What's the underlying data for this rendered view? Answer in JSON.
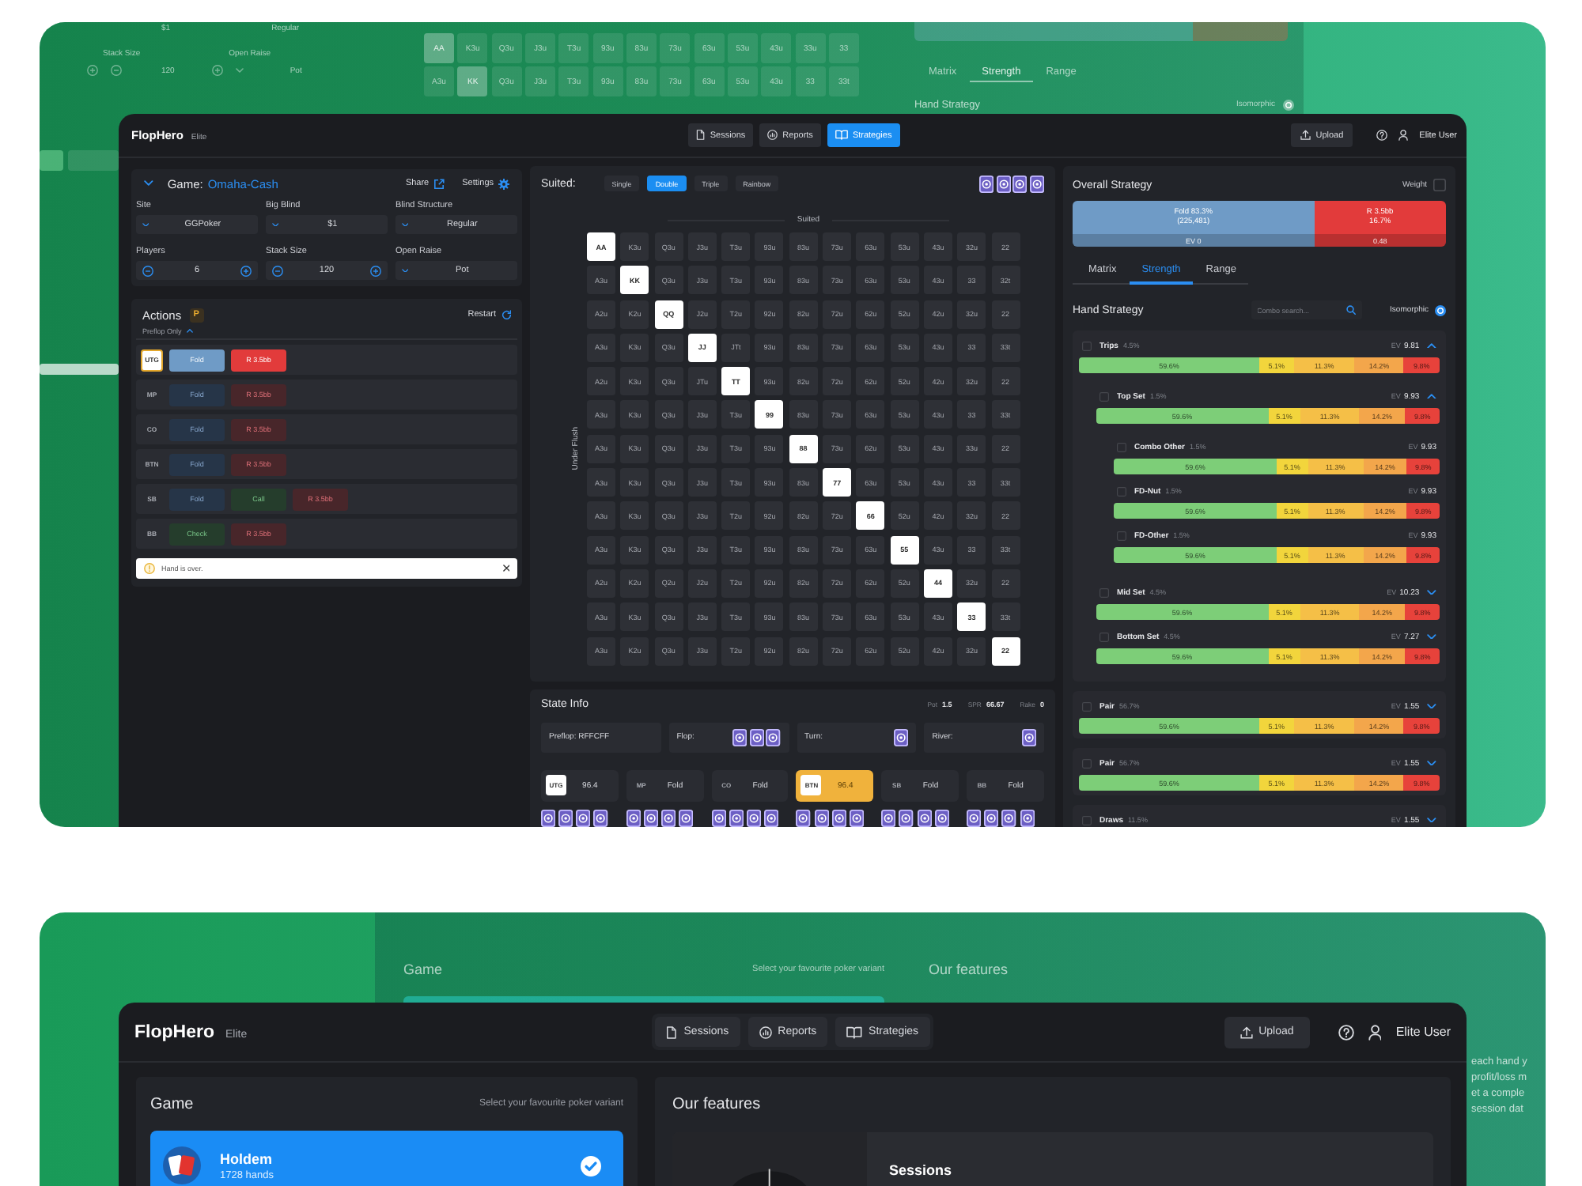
{
  "top_backdrop": {
    "field_values": [
      "$1",
      "Regular"
    ],
    "field_labels": [
      "Stack Size",
      "Open Raise"
    ],
    "stack_size": "120",
    "open_raise": "Pot",
    "matrix_rows": [
      [
        {
          "label": "AA",
          "selected": true
        },
        {
          "label": "K3u",
          "selected": false
        },
        {
          "label": "Q3u",
          "selected": false
        },
        {
          "label": "J3u",
          "selected": false
        },
        {
          "label": "T3u",
          "selected": false
        },
        {
          "label": "93u",
          "selected": false
        },
        {
          "label": "83u",
          "selected": false
        },
        {
          "label": "73u",
          "selected": false
        },
        {
          "label": "63u",
          "selected": false
        },
        {
          "label": "53u",
          "selected": false
        },
        {
          "label": "43u",
          "selected": false
        },
        {
          "label": "33u",
          "selected": false
        },
        {
          "label": "33",
          "selected": false
        }
      ],
      [
        {
          "label": "A3u",
          "selected": false
        },
        {
          "label": "KK",
          "selected": true
        },
        {
          "label": "Q3u",
          "selected": false
        },
        {
          "label": "J3u",
          "selected": false
        },
        {
          "label": "T3u",
          "selected": false
        },
        {
          "label": "93u",
          "selected": false
        },
        {
          "label": "83u",
          "selected": false
        },
        {
          "label": "73u",
          "selected": false
        },
        {
          "label": "63u",
          "selected": false
        },
        {
          "label": "53u",
          "selected": false
        },
        {
          "label": "43u",
          "selected": false
        },
        {
          "label": "33",
          "selected": false
        },
        {
          "label": "33t",
          "selected": false
        }
      ]
    ],
    "tabs": [
      {
        "label": "Matrix",
        "selected": false
      },
      {
        "label": "Strength",
        "selected": true
      },
      {
        "label": "Range",
        "selected": false
      }
    ],
    "hand_strategy": "Hand Strategy",
    "isomorphic": "Isomorphic"
  },
  "top_window": {
    "header": {
      "brand": "FlopHero",
      "plan": "Elite",
      "nav": [
        {
          "label": "Sessions",
          "selected": false
        },
        {
          "label": "Reports",
          "selected": false
        },
        {
          "label": "Strategies",
          "selected": true
        }
      ],
      "upload": "Upload",
      "user": "Elite User"
    },
    "game": {
      "label": "Game:",
      "value": "Omaha-Cash",
      "share": "Share",
      "settings": "Settings",
      "fields": [
        {
          "kind": "select",
          "label": "Site",
          "value": "GGPoker"
        },
        {
          "kind": "select",
          "label": "Big Blind",
          "value": "$1"
        },
        {
          "kind": "select",
          "label": "Blind Structure",
          "value": "Regular"
        },
        {
          "kind": "stepper",
          "label": "Players",
          "value": "6"
        },
        {
          "kind": "stepper",
          "label": "Stack Size",
          "value": "120"
        },
        {
          "kind": "select",
          "label": "Open Raise",
          "value": "Pot"
        }
      ]
    },
    "actions": {
      "title": "Actions",
      "badge": "P",
      "restart": "Restart",
      "filter": "Preflop Only",
      "rows": [
        {
          "position": "UTG",
          "selected": true,
          "buttons": [
            {
              "label": "Fold",
              "kind": "fold"
            },
            {
              "label": "R 3.5bb",
              "kind": "raise"
            }
          ]
        },
        {
          "position": "MP",
          "selected": false,
          "buttons": [
            {
              "label": "Fold",
              "kind": "fold"
            },
            {
              "label": "R 3.5bb",
              "kind": "raise"
            }
          ]
        },
        {
          "position": "CO",
          "selected": false,
          "buttons": [
            {
              "label": "Fold",
              "kind": "fold"
            },
            {
              "label": "R 3.5bb",
              "kind": "raise"
            }
          ]
        },
        {
          "position": "BTN",
          "selected": false,
          "buttons": [
            {
              "label": "Fold",
              "kind": "fold"
            },
            {
              "label": "R 3.5bb",
              "kind": "raise"
            }
          ]
        },
        {
          "position": "SB",
          "selected": false,
          "buttons": [
            {
              "label": "Fold",
              "kind": "fold"
            },
            {
              "label": "Call",
              "kind": "call"
            },
            {
              "label": "R 3.5bb",
              "kind": "raise"
            }
          ]
        },
        {
          "position": "BB",
          "selected": false,
          "buttons": [
            {
              "label": "Check",
              "kind": "call"
            },
            {
              "label": "R 3.5bb",
              "kind": "raise"
            }
          ]
        }
      ],
      "alert": "Hand is over."
    },
    "suit_filter": {
      "label": "Suited:",
      "options": [
        {
          "label": "Single",
          "selected": false
        },
        {
          "label": "Double",
          "selected": true
        },
        {
          "label": "Triple",
          "selected": false
        },
        {
          "label": "Rainbow",
          "selected": false
        }
      ],
      "cards": [
        {
          "kind": "back"
        },
        {
          "kind": "back"
        },
        {
          "kind": "back"
        },
        {
          "kind": "back"
        }
      ]
    },
    "matrix": {
      "column_title": "Suited",
      "row_title": "Under Flush",
      "rows": [
        [
          {
            "label": "AA",
            "selected": true
          },
          {
            "label": "K3u",
            "selected": false
          },
          {
            "label": "Q3u",
            "selected": false
          },
          {
            "label": "J3u",
            "selected": false
          },
          {
            "label": "T3u",
            "selected": false
          },
          {
            "label": "93u",
            "selected": false
          },
          {
            "label": "83u",
            "selected": false
          },
          {
            "label": "73u",
            "selected": false
          },
          {
            "label": "63u",
            "selected": false
          },
          {
            "label": "53u",
            "selected": false
          },
          {
            "label": "43u",
            "selected": false
          },
          {
            "label": "32u",
            "selected": false
          },
          {
            "label": "22",
            "selected": false
          }
        ],
        [
          {
            "label": "A3u",
            "selected": false
          },
          {
            "label": "KK",
            "selected": true
          },
          {
            "label": "Q3u",
            "selected": false
          },
          {
            "label": "J3u",
            "selected": false
          },
          {
            "label": "T3u",
            "selected": false
          },
          {
            "label": "93u",
            "selected": false
          },
          {
            "label": "83u",
            "selected": false
          },
          {
            "label": "73u",
            "selected": false
          },
          {
            "label": "63u",
            "selected": false
          },
          {
            "label": "53u",
            "selected": false
          },
          {
            "label": "43u",
            "selected": false
          },
          {
            "label": "33",
            "selected": false
          },
          {
            "label": "32t",
            "selected": false
          }
        ],
        [
          {
            "label": "A2u",
            "selected": false
          },
          {
            "label": "K2u",
            "selected": false
          },
          {
            "label": "QQ",
            "selected": true
          },
          {
            "label": "J2u",
            "selected": false
          },
          {
            "label": "T2u",
            "selected": false
          },
          {
            "label": "92u",
            "selected": false
          },
          {
            "label": "82u",
            "selected": false
          },
          {
            "label": "72u",
            "selected": false
          },
          {
            "label": "62u",
            "selected": false
          },
          {
            "label": "52u",
            "selected": false
          },
          {
            "label": "42u",
            "selected": false
          },
          {
            "label": "32u",
            "selected": false
          },
          {
            "label": "22",
            "selected": false
          }
        ],
        [
          {
            "label": "A3u",
            "selected": false
          },
          {
            "label": "K3u",
            "selected": false
          },
          {
            "label": "Q3u",
            "selected": false
          },
          {
            "label": "JJ",
            "selected": true
          },
          {
            "label": "JTt",
            "selected": false
          },
          {
            "label": "93u",
            "selected": false
          },
          {
            "label": "83u",
            "selected": false
          },
          {
            "label": "73u",
            "selected": false
          },
          {
            "label": "63u",
            "selected": false
          },
          {
            "label": "53u",
            "selected": false
          },
          {
            "label": "43u",
            "selected": false
          },
          {
            "label": "33",
            "selected": false
          },
          {
            "label": "33t",
            "selected": false
          }
        ],
        [
          {
            "label": "A2u",
            "selected": false
          },
          {
            "label": "K3u",
            "selected": false
          },
          {
            "label": "Q3u",
            "selected": false
          },
          {
            "label": "JTu",
            "selected": false
          },
          {
            "label": "TT",
            "selected": true
          },
          {
            "label": "93u",
            "selected": false
          },
          {
            "label": "82u",
            "selected": false
          },
          {
            "label": "72u",
            "selected": false
          },
          {
            "label": "62u",
            "selected": false
          },
          {
            "label": "52u",
            "selected": false
          },
          {
            "label": "42u",
            "selected": false
          },
          {
            "label": "32u",
            "selected": false
          },
          {
            "label": "22",
            "selected": false
          }
        ],
        [
          {
            "label": "A3u",
            "selected": false
          },
          {
            "label": "K3u",
            "selected": false
          },
          {
            "label": "Q3u",
            "selected": false
          },
          {
            "label": "J3u",
            "selected": false
          },
          {
            "label": "T3u",
            "selected": false
          },
          {
            "label": "99",
            "selected": true
          },
          {
            "label": "83u",
            "selected": false
          },
          {
            "label": "73u",
            "selected": false
          },
          {
            "label": "63u",
            "selected": false
          },
          {
            "label": "53u",
            "selected": false
          },
          {
            "label": "43u",
            "selected": false
          },
          {
            "label": "33",
            "selected": false
          },
          {
            "label": "33t",
            "selected": false
          }
        ],
        [
          {
            "label": "A3u",
            "selected": false
          },
          {
            "label": "K3u",
            "selected": false
          },
          {
            "label": "Q3u",
            "selected": false
          },
          {
            "label": "J3u",
            "selected": false
          },
          {
            "label": "T3u",
            "selected": false
          },
          {
            "label": "93u",
            "selected": false
          },
          {
            "label": "88",
            "selected": true
          },
          {
            "label": "73u",
            "selected": false
          },
          {
            "label": "62u",
            "selected": false
          },
          {
            "label": "53u",
            "selected": false
          },
          {
            "label": "43u",
            "selected": false
          },
          {
            "label": "33u",
            "selected": false
          },
          {
            "label": "22",
            "selected": false
          }
        ],
        [
          {
            "label": "A3u",
            "selected": false
          },
          {
            "label": "K3u",
            "selected": false
          },
          {
            "label": "Q3u",
            "selected": false
          },
          {
            "label": "J3u",
            "selected": false
          },
          {
            "label": "T3u",
            "selected": false
          },
          {
            "label": "93u",
            "selected": false
          },
          {
            "label": "83u",
            "selected": false
          },
          {
            "label": "77",
            "selected": true
          },
          {
            "label": "63u",
            "selected": false
          },
          {
            "label": "53u",
            "selected": false
          },
          {
            "label": "43u",
            "selected": false
          },
          {
            "label": "33",
            "selected": false
          },
          {
            "label": "33t",
            "selected": false
          }
        ],
        [
          {
            "label": "A3u",
            "selected": false
          },
          {
            "label": "K3u",
            "selected": false
          },
          {
            "label": "Q3u",
            "selected": false
          },
          {
            "label": "J3u",
            "selected": false
          },
          {
            "label": "T2u",
            "selected": false
          },
          {
            "label": "92u",
            "selected": false
          },
          {
            "label": "82u",
            "selected": false
          },
          {
            "label": "72u",
            "selected": false
          },
          {
            "label": "66",
            "selected": true
          },
          {
            "label": "52u",
            "selected": false
          },
          {
            "label": "42u",
            "selected": false
          },
          {
            "label": "32u",
            "selected": false
          },
          {
            "label": "22",
            "selected": false
          }
        ],
        [
          {
            "label": "A3u",
            "selected": false
          },
          {
            "label": "K3u",
            "selected": false
          },
          {
            "label": "Q3u",
            "selected": false
          },
          {
            "label": "J3u",
            "selected": false
          },
          {
            "label": "T3u",
            "selected": false
          },
          {
            "label": "93u",
            "selected": false
          },
          {
            "label": "83u",
            "selected": false
          },
          {
            "label": "73u",
            "selected": false
          },
          {
            "label": "63u",
            "selected": false
          },
          {
            "label": "55",
            "selected": true
          },
          {
            "label": "43u",
            "selected": false
          },
          {
            "label": "33",
            "selected": false
          },
          {
            "label": "33t",
            "selected": false
          }
        ],
        [
          {
            "label": "A2u",
            "selected": false
          },
          {
            "label": "K2u",
            "selected": false
          },
          {
            "label": "Q2u",
            "selected": false
          },
          {
            "label": "J2u",
            "selected": false
          },
          {
            "label": "T2u",
            "selected": false
          },
          {
            "label": "92u",
            "selected": false
          },
          {
            "label": "82u",
            "selected": false
          },
          {
            "label": "72u",
            "selected": false
          },
          {
            "label": "62u",
            "selected": false
          },
          {
            "label": "52u",
            "selected": false
          },
          {
            "label": "44",
            "selected": true
          },
          {
            "label": "32u",
            "selected": false
          },
          {
            "label": "22",
            "selected": false
          }
        ],
        [
          {
            "label": "A3u",
            "selected": false
          },
          {
            "label": "K3u",
            "selected": false
          },
          {
            "label": "Q3u",
            "selected": false
          },
          {
            "label": "J3u",
            "selected": false
          },
          {
            "label": "T3u",
            "selected": false
          },
          {
            "label": "93u",
            "selected": false
          },
          {
            "label": "83u",
            "selected": false
          },
          {
            "label": "73u",
            "selected": false
          },
          {
            "label": "63u",
            "selected": false
          },
          {
            "label": "53u",
            "selected": false
          },
          {
            "label": "43u",
            "selected": false
          },
          {
            "label": "33",
            "selected": true
          },
          {
            "label": "33t",
            "selected": false
          }
        ],
        [
          {
            "label": "A3u",
            "selected": false
          },
          {
            "label": "K2u",
            "selected": false
          },
          {
            "label": "Q3u",
            "selected": false
          },
          {
            "label": "J3u",
            "selected": false
          },
          {
            "label": "T2u",
            "selected": false
          },
          {
            "label": "92u",
            "selected": false
          },
          {
            "label": "82u",
            "selected": false
          },
          {
            "label": "72u",
            "selected": false
          },
          {
            "label": "62u",
            "selected": false
          },
          {
            "label": "52u",
            "selected": false
          },
          {
            "label": "42u",
            "selected": false
          },
          {
            "label": "32u",
            "selected": false
          },
          {
            "label": "22",
            "selected": true
          }
        ]
      ]
    },
    "state_info": {
      "title": "State Info",
      "stats": [
        {
          "label": "Pot",
          "value": "1.5"
        },
        {
          "label": "SPR",
          "value": "66.67"
        },
        {
          "label": "Rake",
          "value": "0"
        }
      ],
      "streets": [
        {
          "label": "Preflop: RFFCFF"
        },
        {
          "label": "Flop:",
          "cards": [
            {
              "kind": "back"
            },
            {
              "kind": "back"
            },
            {
              "kind": "back"
            }
          ]
        },
        {
          "label": "Turn:",
          "cards": [
            {
              "kind": "back"
            }
          ]
        },
        {
          "label": "River:",
          "cards": [
            {
              "kind": "back"
            }
          ]
        }
      ],
      "players": [
        {
          "position": "UTG",
          "value": "96.4",
          "active": true,
          "selected": false
        },
        {
          "position": "MP",
          "value": "Fold",
          "active": false,
          "selected": false
        },
        {
          "position": "CO",
          "value": "Fold",
          "active": false,
          "selected": false
        },
        {
          "position": "BTN",
          "value": "96.4",
          "active": true,
          "selected": true
        },
        {
          "position": "SB",
          "value": "Fold",
          "active": false,
          "selected": false
        },
        {
          "position": "BB",
          "value": "Fold",
          "active": false,
          "selected": false
        }
      ],
      "hands": [
        {
          "cards": [
            {
              "kind": "back"
            },
            {
              "kind": "back"
            },
            {
              "kind": "back"
            },
            {
              "kind": "back"
            }
          ]
        },
        {
          "cards": [
            {
              "kind": "back"
            },
            {
              "kind": "back"
            },
            {
              "kind": "back"
            },
            {
              "kind": "back"
            }
          ]
        },
        {
          "cards": [
            {
              "kind": "back"
            },
            {
              "kind": "back"
            },
            {
              "kind": "back"
            },
            {
              "kind": "back"
            }
          ]
        },
        {
          "cards": [
            {
              "kind": "back"
            },
            {
              "kind": "back"
            },
            {
              "kind": "back"
            },
            {
              "kind": "back"
            }
          ]
        },
        {
          "cards": [
            {
              "kind": "back"
            },
            {
              "kind": "back"
            },
            {
              "kind": "back"
            },
            {
              "kind": "back"
            }
          ]
        },
        {
          "cards": [
            {
              "kind": "back"
            },
            {
              "kind": "back"
            },
            {
              "kind": "back"
            },
            {
              "kind": "back"
            }
          ]
        }
      ]
    },
    "overall": {
      "title": "Overall Strategy",
      "weight": {
        "label": "Weight",
        "checked": false
      },
      "segments": [
        {
          "lines": [
            "Fold 83.3%",
            "(225,481)"
          ],
          "ev": "EV 0",
          "color": "#6f9bc6"
        },
        {
          "lines": [
            "R 3.5bb",
            "16.7%"
          ],
          "ev": "0.48",
          "color": "#e23b3b"
        }
      ]
    },
    "strategy_tabs": [
      {
        "label": "Matrix",
        "selected": false
      },
      {
        "label": "Strength",
        "selected": true
      },
      {
        "label": "Range",
        "selected": false
      }
    ],
    "hand_strategy": {
      "title": "Hand Strategy",
      "search_placeholder": "Combo search...",
      "isomorphic": "Isomorphic",
      "groups": [
        {
          "name": "Trips",
          "share": "4.5%",
          "ev_label": "EV",
          "ev": "9.81",
          "checked": false,
          "expanded": true,
          "bar": [
            {
              "label": "59.6%",
              "color": "#7dce78"
            },
            {
              "label": "5.1%",
              "color": "#f2d53c"
            },
            {
              "label": "11.3%",
              "color": "#f5bf47"
            },
            {
              "label": "14.2%",
              "color": "#f3a64b"
            },
            {
              "label": "9.8%",
              "color": "#e7423b"
            }
          ],
          "children": [
            {
              "name": "Top Set",
              "share": "1.5%",
              "ev_label": "EV",
              "ev": "9.93",
              "checked": false,
              "expanded": true,
              "bar": [
                {
                  "label": "59.6%",
                  "color": "#7dce78"
                },
                {
                  "label": "5.1%",
                  "color": "#f2d53c"
                },
                {
                  "label": "11.3%",
                  "color": "#f5bf47"
                },
                {
                  "label": "14.2%",
                  "color": "#f3a64b"
                },
                {
                  "label": "9.8%",
                  "color": "#e7423b"
                }
              ],
              "children": [
                {
                  "name": "Combo Other",
                  "share": "1.5%",
                  "ev_label": "EV",
                  "ev": "9.93",
                  "checked": false,
                  "bar": [
                    {
                      "label": "59.6%",
                      "color": "#7dce78"
                    },
                    {
                      "label": "5.1%",
                      "color": "#f2d53c"
                    },
                    {
                      "label": "11.3%",
                      "color": "#f5bf47"
                    },
                    {
                      "label": "14.2%",
                      "color": "#f3a64b"
                    },
                    {
                      "label": "9.8%",
                      "color": "#e7423b"
                    }
                  ]
                },
                {
                  "name": "FD-Nut",
                  "share": "1.5%",
                  "ev_label": "EV",
                  "ev": "9.93",
                  "checked": false,
                  "bar": [
                    {
                      "label": "59.6%",
                      "color": "#7dce78"
                    },
                    {
                      "label": "5.1%",
                      "color": "#f2d53c"
                    },
                    {
                      "label": "11.3%",
                      "color": "#f5bf47"
                    },
                    {
                      "label": "14.2%",
                      "color": "#f3a64b"
                    },
                    {
                      "label": "9.8%",
                      "color": "#e7423b"
                    }
                  ]
                },
                {
                  "name": "FD-Other",
                  "share": "1.5%",
                  "ev_label": "EV",
                  "ev": "9.93",
                  "checked": false,
                  "bar": [
                    {
                      "label": "59.6%",
                      "color": "#7dce78"
                    },
                    {
                      "label": "5.1%",
                      "color": "#f2d53c"
                    },
                    {
                      "label": "11.3%",
                      "color": "#f5bf47"
                    },
                    {
                      "label": "14.2%",
                      "color": "#f3a64b"
                    },
                    {
                      "label": "9.8%",
                      "color": "#e7423b"
                    }
                  ]
                }
              ]
            },
            {
              "name": "Mid Set",
              "share": "4.5%",
              "ev_label": "EV",
              "ev": "10.23",
              "checked": false,
              "expanded": false,
              "bar": [
                {
                  "label": "59.6%",
                  "color": "#7dce78"
                },
                {
                  "label": "5.1%",
                  "color": "#f2d53c"
                },
                {
                  "label": "11.3%",
                  "color": "#f5bf47"
                },
                {
                  "label": "14.2%",
                  "color": "#f3a64b"
                },
                {
                  "label": "9.8%",
                  "color": "#e7423b"
                }
              ]
            },
            {
              "name": "Bottom Set",
              "share": "4.5%",
              "ev_label": "EV",
              "ev": "7.27",
              "checked": false,
              "expanded": false,
              "bar": [
                {
                  "label": "59.6%",
                  "color": "#7dce78"
                },
                {
                  "label": "5.1%",
                  "color": "#f2d53c"
                },
                {
                  "label": "11.3%",
                  "color": "#f5bf47"
                },
                {
                  "label": "14.2%",
                  "color": "#f3a64b"
                },
                {
                  "label": "9.8%",
                  "color": "#e7423b"
                }
              ]
            }
          ]
        },
        {
          "name": "Pair",
          "share": "56.7%",
          "ev_label": "EV",
          "ev": "1.55",
          "checked": false,
          "expanded": false,
          "bar": [
            {
              "label": "59.6%",
              "color": "#7dce78"
            },
            {
              "label": "5.1%",
              "color": "#f2d53c"
            },
            {
              "label": "11.3%",
              "color": "#f5bf47"
            },
            {
              "label": "14.2%",
              "color": "#f3a64b"
            },
            {
              "label": "9.8%",
              "color": "#e7423b"
            }
          ]
        },
        {
          "name": "Pair",
          "share": "56.7%",
          "ev_label": "EV",
          "ev": "1.55",
          "checked": false,
          "expanded": false,
          "bar": [
            {
              "label": "59.6%",
              "color": "#7dce78"
            },
            {
              "label": "5.1%",
              "color": "#f2d53c"
            },
            {
              "label": "11.3%",
              "color": "#f5bf47"
            },
            {
              "label": "14.2%",
              "color": "#f3a64b"
            },
            {
              "label": "9.8%",
              "color": "#e7423b"
            }
          ]
        },
        {
          "name": "Draws",
          "share": "11.5%",
          "ev_label": "EV",
          "ev": "1.55",
          "checked": false,
          "expanded": false
        }
      ]
    }
  },
  "bottom_backdrop": {
    "game_title": "Game",
    "game_subtitle": "Select your favourite poker variant",
    "features_title": "Our features",
    "side_lines": [
      "each hand y",
      "profit/loss m",
      "et a comple",
      "session dat"
    ]
  },
  "bottom_window": {
    "header": {
      "brand": "FlopHero",
      "plan": "Elite",
      "nav": [
        {
          "label": "Sessions",
          "selected": false
        },
        {
          "label": "Reports",
          "selected": false
        },
        {
          "label": "Strategies",
          "selected": false
        }
      ],
      "upload": "Upload",
      "user": "Elite User"
    },
    "game": {
      "title": "Game",
      "subtitle": "Select your favourite poker variant",
      "variants": [
        {
          "name": "Holdem",
          "hands": "1728 hands",
          "selected": true
        }
      ]
    },
    "features": {
      "title": "Our features",
      "items": [
        {
          "title": "Sessions"
        }
      ]
    }
  }
}
